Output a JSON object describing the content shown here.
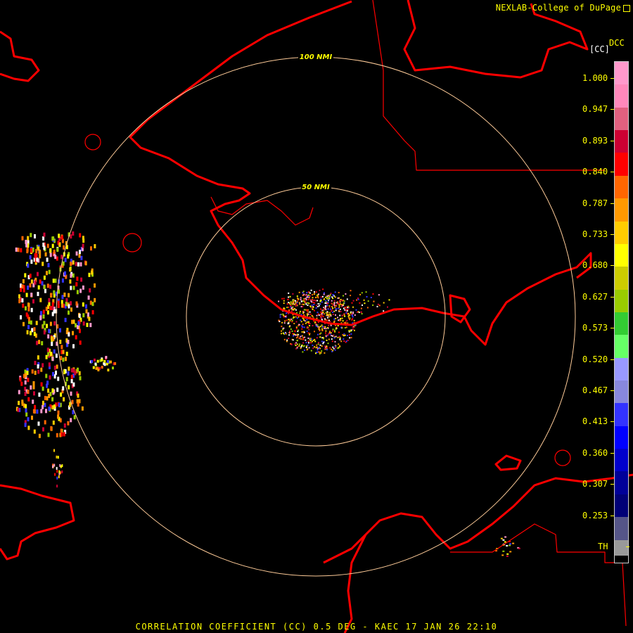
{
  "credit": "NEXLAB-College of DuPage",
  "footer": "CORRELATION COEFFICIENT (CC) 0.5 DEG - KAEC 17 JAN 26 22:10",
  "colorbar": {
    "product": "DCC",
    "units": "[CC]",
    "ticks": [
      "1.000",
      "0.947",
      "0.893",
      "0.840",
      "0.787",
      "0.733",
      "0.680",
      "0.627",
      "0.573",
      "0.520",
      "0.467",
      "0.413",
      "0.360",
      "0.307",
      "0.253",
      "TH"
    ],
    "colors": [
      "#ff99cc",
      "#ff88bb",
      "#e0607f",
      "#cc0033",
      "#ff0000",
      "#ff6600",
      "#ff9900",
      "#ffcc00",
      "#ffff00",
      "#cccc00",
      "#99cc00",
      "#33cc33",
      "#66ff66",
      "#9999ff",
      "#8888dd",
      "#3333ff",
      "#0000ff",
      "#0000cc",
      "#000099",
      "#000077",
      "#555588",
      "#999999"
    ]
  },
  "range_rings": [
    {
      "label": "50 NMI",
      "radius_nmi": 50
    },
    {
      "label": "100 NMI",
      "radius_nmi": 100
    }
  ],
  "colors": {
    "background": "#000000",
    "coastline": "#ff0000",
    "range_ring": "#ffcc99",
    "text": "#ffff00"
  }
}
